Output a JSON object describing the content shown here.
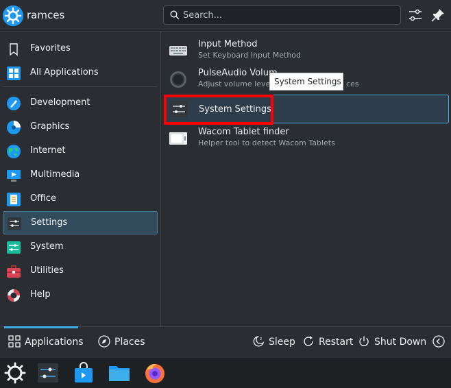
{
  "header": {
    "username": "ramces",
    "search_placeholder": "Search..."
  },
  "sidebar": {
    "items": [
      {
        "label": "Favorites",
        "icon": "bookmark-icon"
      },
      {
        "label": "All Applications",
        "icon": "grid-icon"
      },
      {
        "label": "Development",
        "icon": "development-icon"
      },
      {
        "label": "Graphics",
        "icon": "graphics-icon"
      },
      {
        "label": "Internet",
        "icon": "globe-icon"
      },
      {
        "label": "Multimedia",
        "icon": "multimedia-icon"
      },
      {
        "label": "Office",
        "icon": "office-icon"
      },
      {
        "label": "Settings",
        "icon": "settings-icon",
        "selected": true
      },
      {
        "label": "System",
        "icon": "system-icon"
      },
      {
        "label": "Utilities",
        "icon": "toolbox-icon"
      },
      {
        "label": "Help",
        "icon": "lifebuoy-icon"
      }
    ]
  },
  "apps": [
    {
      "name": "Input Method",
      "desc": "Set Keyboard Input Method"
    },
    {
      "name": "PulseAudio Volum",
      "desc": "Adjust volume levels"
    },
    {
      "name": "System Settings",
      "desc": ""
    },
    {
      "name": "Wacom Tablet finder",
      "desc": "Helper tool to detect Wacom Tablets"
    }
  ],
  "pulse_overflow": {
    "name_tail": "",
    "desc_tail": "ces"
  },
  "tooltip": "System Settings",
  "bottom": {
    "applications": "Applications",
    "places": "Places",
    "sleep": "Sleep",
    "restart": "Restart",
    "shutdown": "Shut Down"
  },
  "colors": {
    "accent": "#3daee9",
    "highlight": "#ff0000",
    "background": "#2a2e32"
  },
  "taskbar": {
    "items": [
      "kde-menu-icon",
      "system-settings-icon",
      "discover-icon",
      "dolphin-folder-icon",
      "firefox-icon"
    ]
  }
}
